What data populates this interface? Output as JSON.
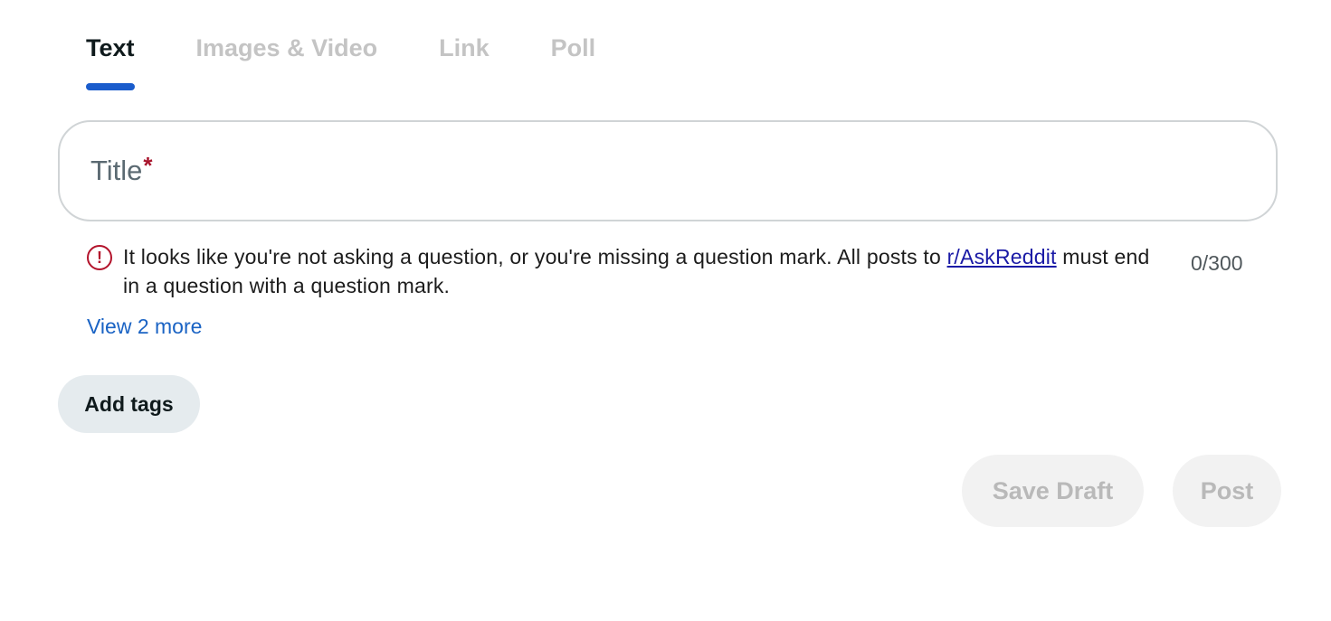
{
  "tabs": [
    {
      "label": "Text",
      "active": true
    },
    {
      "label": "Images & Video",
      "active": false
    },
    {
      "label": "Link",
      "active": false
    },
    {
      "label": "Poll",
      "active": false
    }
  ],
  "title_field": {
    "placeholder": "Title",
    "required_marker": "*",
    "value": ""
  },
  "warning": {
    "icon": "error-circle-icon",
    "text_before_link": "It looks like you're not asking a question, or you're missing a question mark. All posts to ",
    "link_text": "r/AskReddit",
    "text_after_link": " must end in a question with a question mark."
  },
  "char_count": "0/300",
  "view_more_label": "View 2 more",
  "add_tags_label": "Add tags",
  "buttons": {
    "save_draft_label": "Save Draft",
    "post_label": "Post"
  },
  "colors": {
    "active_tab_underline": "#1a5ccc",
    "warning_red": "#b3132b",
    "link_blue": "#1a63c4"
  }
}
